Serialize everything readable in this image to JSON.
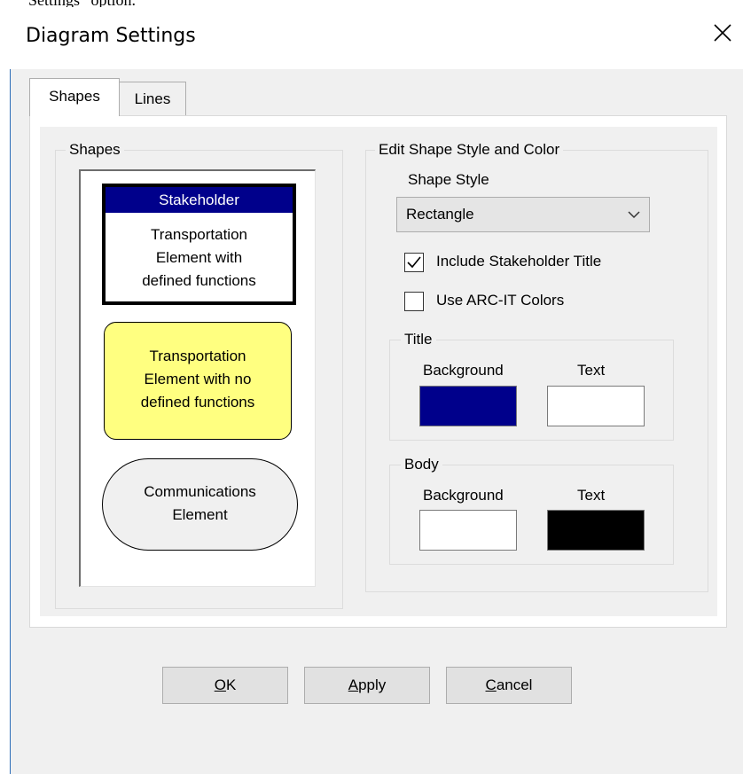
{
  "background_caption": "“Settings” option.",
  "window": {
    "title": "Diagram Settings",
    "close_icon": "close-icon"
  },
  "tabs": [
    {
      "label": "Shapes",
      "active": true
    },
    {
      "label": "Lines",
      "active": false
    }
  ],
  "shapes_group": {
    "legend": "Shapes",
    "stakeholder": {
      "title": "Stakeholder",
      "body": [
        "Transportation",
        "Element with",
        "defined functions"
      ],
      "title_color": "#00008b"
    },
    "no_functions": {
      "body": [
        "Transportation",
        "Element with no",
        "defined functions"
      ],
      "fill_color": "#ffff80"
    },
    "communications": {
      "body": [
        "Communications",
        "Element"
      ]
    }
  },
  "edit_group": {
    "legend": "Edit Shape Style and Color",
    "shape_style_label": "Shape Style",
    "shape_style_value": "Rectangle",
    "include_title": {
      "label": "Include Stakeholder Title",
      "checked": true
    },
    "use_arc_it": {
      "label": "Use ARC-IT Colors",
      "checked": false
    },
    "title_section": {
      "legend": "Title",
      "background_label": "Background",
      "text_label": "Text",
      "background_color": "#00008b",
      "text_color": "#ffffff"
    },
    "body_section": {
      "legend": "Body",
      "background_label": "Background",
      "text_label": "Text",
      "background_color": "#ffffff",
      "text_color": "#000000"
    }
  },
  "buttons": {
    "ok": {
      "mnemonic": "O",
      "rest": "K"
    },
    "apply": {
      "mnemonic": "A",
      "rest": "pply"
    },
    "cancel": {
      "mnemonic": "C",
      "rest": "ancel"
    }
  }
}
